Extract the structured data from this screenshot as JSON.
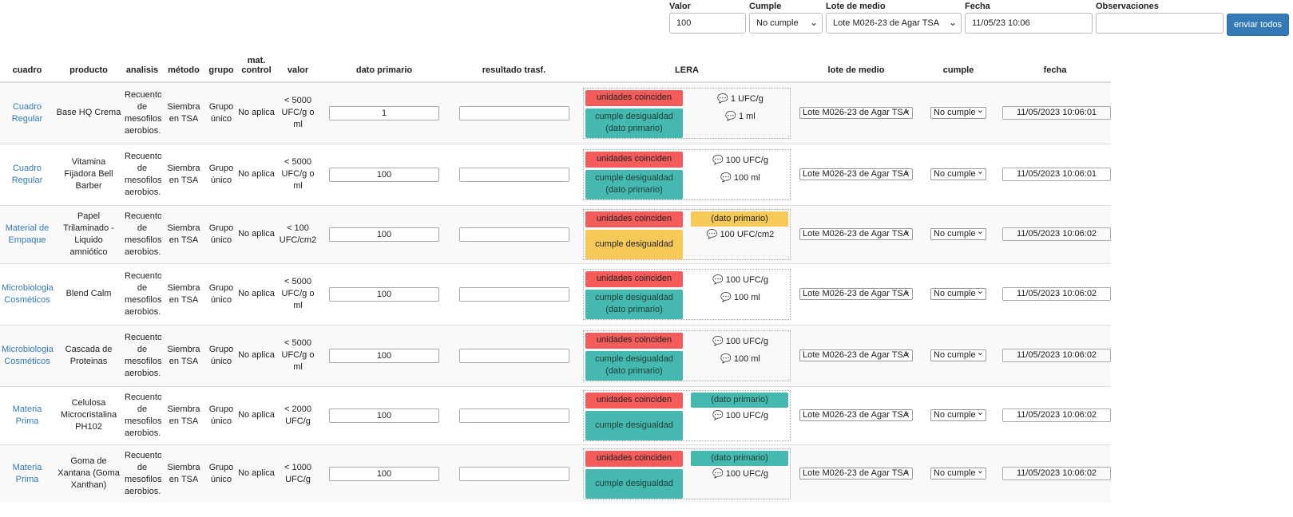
{
  "bulk": {
    "valor_label": "Valor",
    "valor_value": "100",
    "cumple_label": "Cumple",
    "cumple_value": "No cumple",
    "lote_label": "Lote de medio",
    "lote_value": "Lote M026-23 de Agar TSA",
    "fecha_label": "Fecha",
    "fecha_value": "11/05/23 10:06",
    "obs_label": "Observaciones",
    "obs_value": "",
    "send_label": "enviar todos"
  },
  "headers": {
    "cuadro": "cuadro",
    "producto": "producto",
    "analisis": "analisis",
    "metodo": "método",
    "grupo": "grupo",
    "matcontrol": "mat. control",
    "valor": "valor",
    "dato": "dato primario",
    "resultado": "resultado trasf.",
    "lera": "LERA",
    "lote": "lote de medio",
    "cumple": "cumple",
    "fecha": "fecha"
  },
  "rows": [
    {
      "cuadro": "Cuadro Regular",
      "producto": "Base HQ Crema",
      "analisis": "Recuento de mesofilos aerobios.",
      "metodo": "Siembra en TSA",
      "grupo": "Grupo único",
      "matcontrol": "No aplica",
      "valor": "< 5000 UFC/g o ml",
      "dato": "1",
      "red": "unidades coinciden",
      "main": "cumple desigualdad",
      "main2": "(dato primario)",
      "mainColor": "green",
      "pill": "",
      "pillColor": "",
      "note1": "💬 1 UFC/g",
      "note2": "💬 1 ml",
      "lote": "Lote M026-23 de Agar TSA",
      "cumple": "No cumple",
      "fecha": "11/05/2023 10:06:01"
    },
    {
      "cuadro": "Cuadro Regular",
      "producto": "Vitamina Fijadora Bell Barber",
      "analisis": "Recuento de mesofilos aerobios.",
      "metodo": "Siembra en TSA",
      "grupo": "Grupo único",
      "matcontrol": "No aplica",
      "valor": "< 5000 UFC/g o ml",
      "dato": "100",
      "red": "unidades coinciden",
      "main": "cumple desigualdad",
      "main2": "(dato primario)",
      "mainColor": "green",
      "pill": "",
      "pillColor": "",
      "note1": "💬 100 UFC/g",
      "note2": "💬 100 ml",
      "lote": "Lote M026-23 de Agar TSA",
      "cumple": "No cumple",
      "fecha": "11/05/2023 10:06:01"
    },
    {
      "cuadro": "Material de Empaque",
      "producto": "Papel Trilaminado - Liquido amniótico",
      "analisis": "Recuento de mesofilos aerobios.",
      "metodo": "Siembra en TSA",
      "grupo": "Grupo único",
      "matcontrol": "No aplica",
      "valor": "< 100 UFC/cm2",
      "dato": "100",
      "red": "unidades coinciden",
      "main": "cumple desigualdad",
      "main2": "",
      "mainColor": "yellow",
      "pill": "(dato primario)",
      "pillColor": "py",
      "note1": "💬 100 UFC/cm2",
      "note2": "",
      "lote": "Lote M026-23 de Agar TSA",
      "cumple": "No cumple",
      "fecha": "11/05/2023 10:06:02"
    },
    {
      "cuadro": "Microbiologia Cosméticos",
      "producto": "Blend Calm",
      "analisis": "Recuento de mesofilos aerobios.",
      "metodo": "Siembra en TSA",
      "grupo": "Grupo único",
      "matcontrol": "No aplica",
      "valor": "< 5000 UFC/g o ml",
      "dato": "100",
      "red": "unidades coinciden",
      "main": "cumple desigualdad",
      "main2": "(dato primario)",
      "mainColor": "green",
      "pill": "",
      "pillColor": "",
      "note1": "💬 100 UFC/g",
      "note2": "💬 100 ml",
      "lote": "Lote M026-23 de Agar TSA",
      "cumple": "No cumple",
      "fecha": "11/05/2023 10:06:02"
    },
    {
      "cuadro": "Microbiologia Cosméticos",
      "producto": "Cascada de Proteinas",
      "analisis": "Recuento de mesofilos aerobios.",
      "metodo": "Siembra en TSA",
      "grupo": "Grupo único",
      "matcontrol": "No aplica",
      "valor": "< 5000 UFC/g o ml",
      "dato": "100",
      "red": "unidades coinciden",
      "main": "cumple desigualdad",
      "main2": "(dato primario)",
      "mainColor": "green",
      "pill": "",
      "pillColor": "",
      "note1": "💬 100 UFC/g",
      "note2": "💬 100 ml",
      "lote": "Lote M026-23 de Agar TSA",
      "cumple": "No cumple",
      "fecha": "11/05/2023 10:06:02"
    },
    {
      "cuadro": "Materia Prima",
      "producto": "Celulosa Microcristalina PH102",
      "analisis": "Recuento de mesofilos aerobios.",
      "metodo": "Siembra en TSA",
      "grupo": "Grupo único",
      "matcontrol": "No aplica",
      "valor": "< 2000 UFC/g",
      "dato": "100",
      "red": "unidades coinciden",
      "main": "cumple desigualdad",
      "main2": "",
      "mainColor": "green",
      "pill": "(dato primario)",
      "pillColor": "pg",
      "note1": "💬 100 UFC/g",
      "note2": "",
      "lote": "Lote M026-23 de Agar TSA",
      "cumple": "No cumple",
      "fecha": "11/05/2023 10:06:02"
    },
    {
      "cuadro": "Materia Prima",
      "producto": "Goma de Xantana (Goma Xanthan)",
      "analisis": "Recuento de mesofilos aerobios.",
      "metodo": "Siembra en TSA",
      "grupo": "Grupo único",
      "matcontrol": "No aplica",
      "valor": "< 1000 UFC/g",
      "dato": "100",
      "red": "unidades coinciden",
      "main": "cumple desigualdad",
      "main2": "",
      "mainColor": "green",
      "pill": "(dato primario)",
      "pillColor": "pg",
      "note1": "💬 100 UFC/g",
      "note2": "",
      "lote": "Lote M026-23 de Agar TSA",
      "cumple": "No cumple",
      "fecha": "11/05/2023 10:06:02"
    }
  ],
  "colors": {
    "link": "#337ab7",
    "red": "#f45b5b",
    "green": "#45b9af",
    "yellow": "#f7c957",
    "button": "#337ab7"
  }
}
